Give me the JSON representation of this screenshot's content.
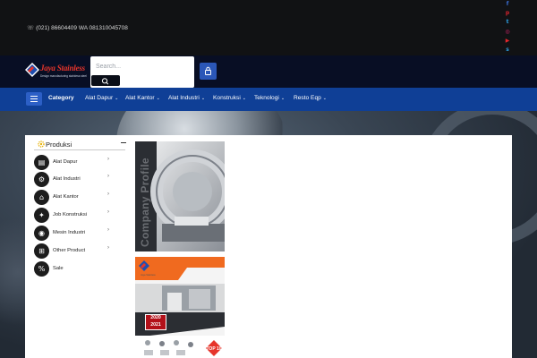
{
  "topbar": {
    "contact": "(021) 86604409 WA 081310045708",
    "social": [
      {
        "icon": "facebook-icon",
        "glyph": "f",
        "color": "#3b6fd8"
      },
      {
        "icon": "pinterest-icon",
        "glyph": "p",
        "color": "#d8242e"
      },
      {
        "icon": "twitter-icon",
        "glyph": "t",
        "color": "#2fa3e6"
      },
      {
        "icon": "instagram-icon",
        "glyph": "◎",
        "color": "#d8246e"
      },
      {
        "icon": "youtube-icon",
        "glyph": "▶",
        "color": "#e5262b"
      },
      {
        "icon": "skype-icon",
        "glyph": "s",
        "color": "#2ea0e0"
      }
    ]
  },
  "header": {
    "logo_name": "Jaya Stainless",
    "logo_tagline": "Design manufacturing stainless steel",
    "search_placeholder": "Search..."
  },
  "nav": {
    "items": [
      {
        "label": "Category",
        "bold": true,
        "has_caret": false
      },
      {
        "label": "Alat Dapur",
        "bold": false,
        "has_caret": true
      },
      {
        "label": "Alat Kantor",
        "bold": false,
        "has_caret": true
      },
      {
        "label": "Alat Industri",
        "bold": false,
        "has_caret": true
      },
      {
        "label": "Konstruksi",
        "bold": false,
        "has_caret": true
      },
      {
        "label": "Teknologi",
        "bold": false,
        "has_caret": true
      },
      {
        "label": "Resto Eqp",
        "bold": false,
        "has_caret": true
      }
    ],
    "caret": "⌄"
  },
  "sidebar": {
    "title": "Produksi",
    "items": [
      {
        "label": "Alat Dapur",
        "icon": "kitchen-icon",
        "has_arrow": true
      },
      {
        "label": "Alat Industri",
        "icon": "industry-icon",
        "has_arrow": true
      },
      {
        "label": "Alat Kantor",
        "icon": "office-icon",
        "has_arrow": true
      },
      {
        "label": "Job Konstruksi",
        "icon": "construction-icon",
        "has_arrow": true
      },
      {
        "label": "Mesin Industri",
        "icon": "machine-icon",
        "has_arrow": true
      },
      {
        "label": "Other Product",
        "icon": "cart-icon",
        "has_arrow": true
      },
      {
        "label": "Sale",
        "icon": "sale-icon",
        "has_arrow": false
      }
    ],
    "arrow": "›"
  },
  "banners": {
    "profile_text": "Company Profile",
    "catalog_logo_tag": "Jaya Stainless",
    "year_top": "2020",
    "year_bottom": "2021",
    "badge": "TOP 10"
  },
  "colors": {
    "nav": "#0f3f96",
    "header": "#080e24",
    "topbar": "#111214",
    "accent_red": "#e6352b",
    "accent_orange": "#f06a1f"
  }
}
